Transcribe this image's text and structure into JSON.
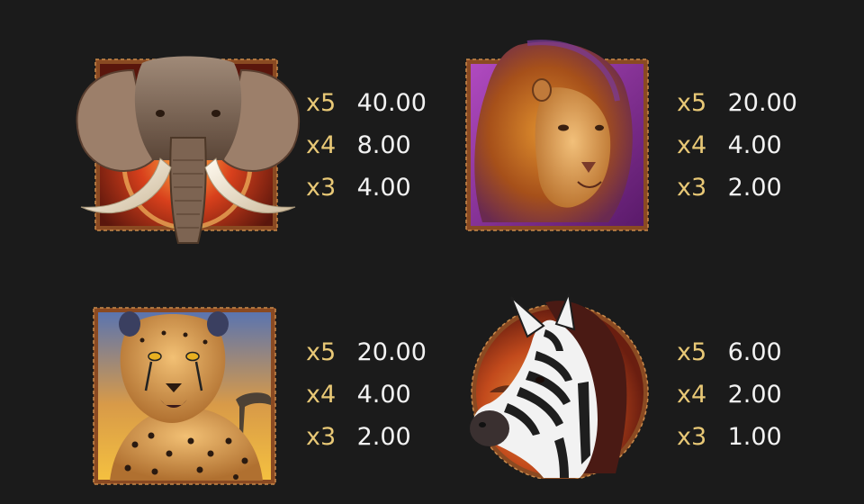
{
  "symbols": [
    {
      "id": "elephant",
      "icon": "elephant-icon",
      "payouts": [
        {
          "mult": "x5",
          "amount": "40.00"
        },
        {
          "mult": "x4",
          "amount": "8.00"
        },
        {
          "mult": "x3",
          "amount": "4.00"
        }
      ]
    },
    {
      "id": "lion",
      "icon": "lion-icon",
      "payouts": [
        {
          "mult": "x5",
          "amount": "20.00"
        },
        {
          "mult": "x4",
          "amount": "4.00"
        },
        {
          "mult": "x3",
          "amount": "2.00"
        }
      ]
    },
    {
      "id": "cheetah",
      "icon": "cheetah-icon",
      "payouts": [
        {
          "mult": "x5",
          "amount": "20.00"
        },
        {
          "mult": "x4",
          "amount": "4.00"
        },
        {
          "mult": "x3",
          "amount": "2.00"
        }
      ]
    },
    {
      "id": "zebra",
      "icon": "zebra-icon",
      "payouts": [
        {
          "mult": "x5",
          "amount": "6.00"
        },
        {
          "mult": "x4",
          "amount": "2.00"
        },
        {
          "mult": "x3",
          "amount": "1.00"
        }
      ]
    }
  ],
  "colors": {
    "background": "#1b1b1b",
    "multiplier": "#e8c876",
    "amount": "#f2f2f2",
    "frame": "#8a4a22"
  }
}
